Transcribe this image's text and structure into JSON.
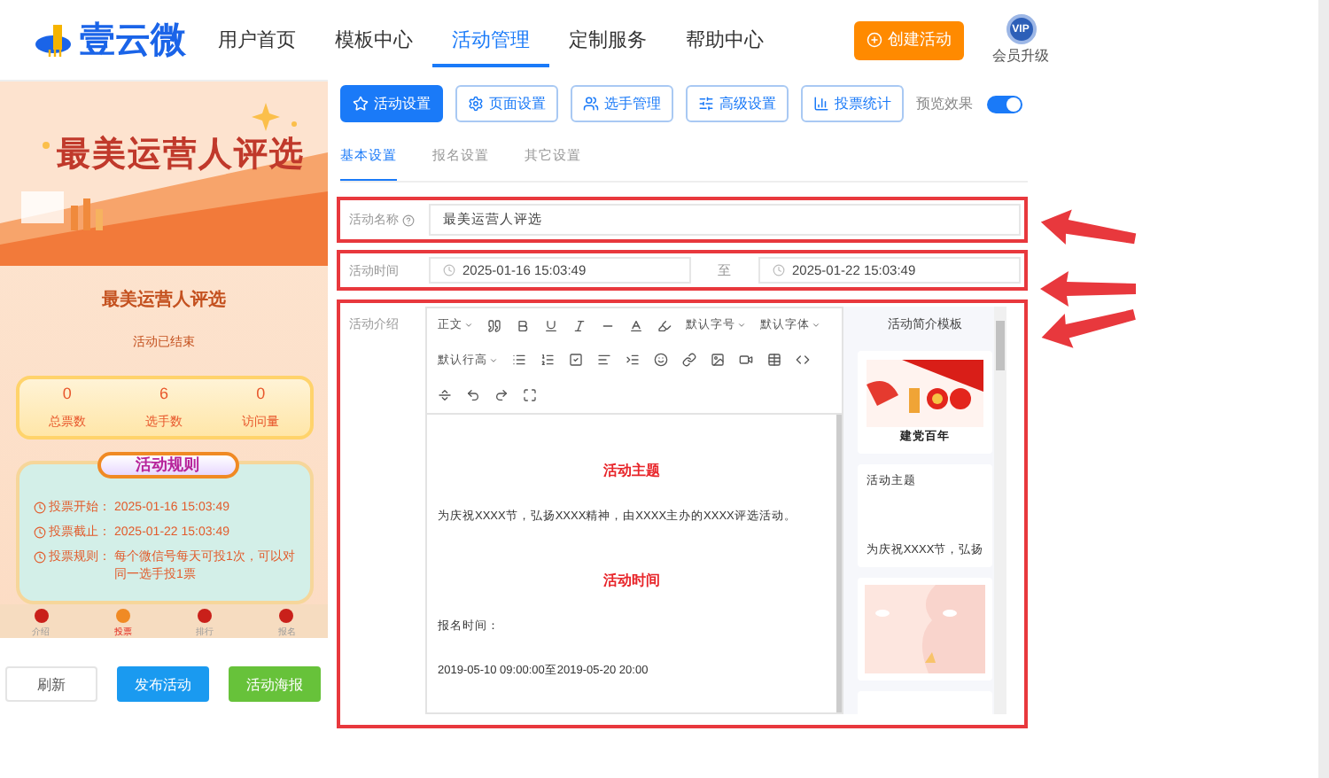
{
  "nav": {
    "logo": "壹云微",
    "items": [
      {
        "label": "用户首页",
        "selected": false
      },
      {
        "label": "模板中心",
        "selected": false
      },
      {
        "label": "活动管理",
        "selected": true
      },
      {
        "label": "定制服务",
        "selected": false
      },
      {
        "label": "帮助中心",
        "selected": false
      }
    ],
    "create_button": "创建活动",
    "vip_badge": "VIP",
    "vip_label": "会员升级"
  },
  "preview": {
    "banner_title": "最美运营人评选",
    "name": "最美运营人评选",
    "status": "活动已结束",
    "stats": [
      {
        "value": "0",
        "label": "总票数"
      },
      {
        "value": "6",
        "label": "选手数"
      },
      {
        "value": "0",
        "label": "访问量"
      }
    ],
    "rules_title": "活动规则",
    "rules": [
      {
        "label": "投票开始：",
        "value": "2025-01-16 15:03:49"
      },
      {
        "label": "投票截止：",
        "value": "2025-01-22 15:03:49"
      },
      {
        "label": "投票规则：",
        "value": "每个微信号每天可投1次，可以对同一选手投1票"
      }
    ],
    "tabbar": [
      {
        "label": "介绍",
        "selected": false
      },
      {
        "label": "投票",
        "selected": true
      },
      {
        "label": "排行",
        "selected": false
      },
      {
        "label": "报名",
        "selected": false
      }
    ]
  },
  "actions": [
    {
      "label": "刷新",
      "kind": "plain"
    },
    {
      "label": "发布活动",
      "kind": "primary"
    },
    {
      "label": "活动海报",
      "kind": "success"
    }
  ],
  "settings_buttons": [
    {
      "label": "活动设置",
      "selected": true
    },
    {
      "label": "页面设置",
      "selected": false
    },
    {
      "label": "选手管理",
      "selected": false
    },
    {
      "label": "高级设置",
      "selected": false
    },
    {
      "label": "投票统计",
      "selected": false
    }
  ],
  "preview_toggle": {
    "label": "预览效果",
    "on": true
  },
  "subtabs": [
    {
      "label": "基本设置",
      "selected": true
    },
    {
      "label": "报名设置",
      "selected": false
    },
    {
      "label": "其它设置",
      "selected": false
    }
  ],
  "form": {
    "name_label": "活动名称",
    "name_value": "最美运营人评选",
    "time_label": "活动时间",
    "start": "2025-01-16 15:03:49",
    "separator": "至",
    "end": "2025-01-22 15:03:49",
    "intro_label": "活动介绍"
  },
  "toolbar": {
    "paragraph": "正文",
    "font_size": "默认字号",
    "font_family": "默认字体",
    "line_height": "默认行高"
  },
  "editor_content": [
    {
      "kind": "heading",
      "text": "活动主题"
    },
    {
      "kind": "text",
      "text": "为庆祝XXXX节，弘扬XXXX精神，由XXXX主办的XXXX评选活动。"
    },
    {
      "kind": "heading",
      "text": "活动时间"
    },
    {
      "kind": "text",
      "text": "报名时间："
    },
    {
      "kind": "text",
      "text": "2019-05-10 09:00:00至2019-05-20 20:00"
    }
  ],
  "templates": {
    "title": "活动简介模板",
    "cards": [
      {
        "kind": "festive",
        "caption": "建党百年"
      },
      {
        "kind": "text",
        "heading": "活动主题",
        "caption": "为庆祝XXXX节，弘扬"
      },
      {
        "kind": "pink"
      },
      {
        "kind": "blank"
      }
    ]
  }
}
